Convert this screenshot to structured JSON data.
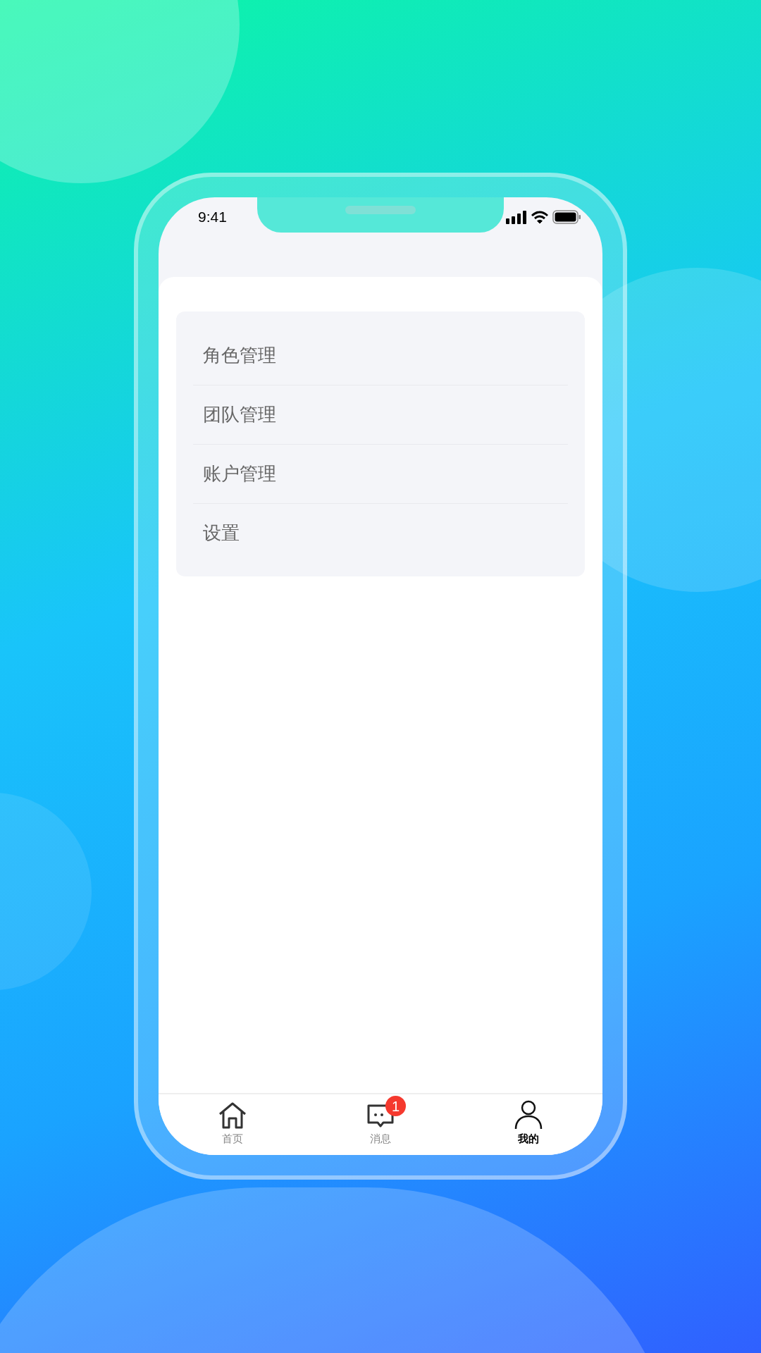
{
  "status_bar": {
    "time": "9:41"
  },
  "menu": {
    "items": [
      {
        "label": "角色管理"
      },
      {
        "label": "团队管理"
      },
      {
        "label": "账户管理"
      },
      {
        "label": "设置"
      }
    ]
  },
  "tab_bar": {
    "tabs": [
      {
        "label": "首页",
        "kind": "home",
        "selected": false
      },
      {
        "label": "消息",
        "kind": "message",
        "selected": false,
        "badge": "1"
      },
      {
        "label": "我的",
        "kind": "profile",
        "selected": true
      }
    ]
  }
}
